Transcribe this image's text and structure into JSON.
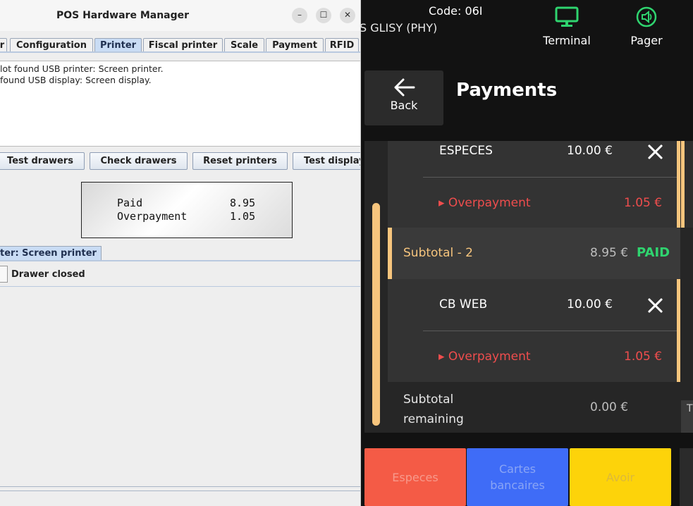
{
  "pos": {
    "code_text": "Code:  06I",
    "store_text": "S GLISY (PHY)",
    "terminal_label": "Terminal",
    "pager_label": "Pager",
    "back_label": "Back",
    "page_title": "Payments",
    "accent_color": "#f7c57d",
    "payments": [
      {
        "method": "ESPECES",
        "amount": "10.00 €",
        "overpayment_label": "▸ Overpayment",
        "overpayment_amount": "1.05 €"
      },
      {
        "method": "CB WEB",
        "amount": "10.00 €",
        "overpayment_label": "▸ Overpayment",
        "overpayment_amount": "1.05 €"
      }
    ],
    "subtotal_paid": {
      "label": "Subtotal - 2",
      "amount": "8.95 €",
      "status": "PAID"
    },
    "subtotal_remaining": {
      "label_line1": "Subtotal",
      "label_line2": "remaining",
      "amount": "0.00 €"
    },
    "right_tab_text": "T",
    "buttons": {
      "especes": "Especes",
      "cartes_line1": "Cartes",
      "cartes_line2": "bancaires",
      "avoir": "Avoir"
    }
  },
  "hw": {
    "window_title": "POS Hardware Manager",
    "win_minimize": "–",
    "win_maximize": "☐",
    "win_close": "✕",
    "tabs": [
      "r",
      "Configuration",
      "Printer",
      "Fiscal printer",
      "Scale",
      "Payment",
      "RFID"
    ],
    "active_tab": "Printer",
    "log_lines": [
      "lot found USB printer: Screen printer.",
      " found USB display: Screen display."
    ],
    "action_buttons": [
      "Test drawers",
      "Check drawers",
      "Reset printers",
      "Test display"
    ],
    "display_lines": [
      {
        "label": "Paid",
        "value": "8.95"
      },
      {
        "label": "Overpayment",
        "value": "1.05"
      }
    ],
    "printer_tab_label": "ter: Screen printer",
    "drawer_status": "Drawer closed"
  }
}
